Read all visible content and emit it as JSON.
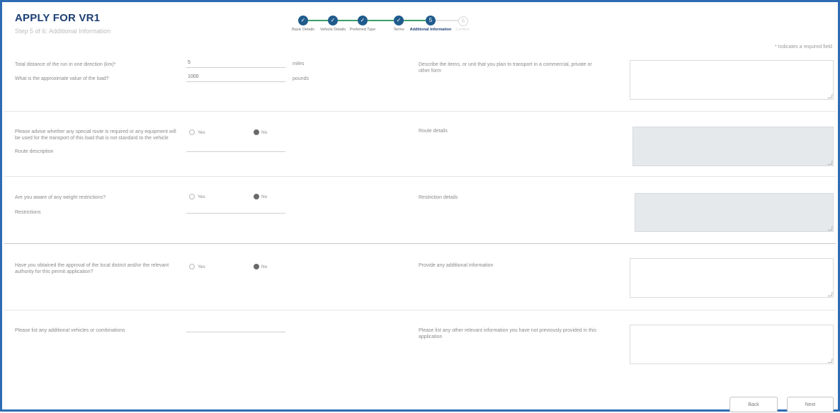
{
  "header": {
    "title": "APPLY FOR VR1",
    "subtitle": "Step 5 of 6: Additional Information"
  },
  "stepper": {
    "steps": [
      {
        "label": "Basic Details",
        "number": "✓"
      },
      {
        "label": "Vehicle Details",
        "number": "✓"
      },
      {
        "label": "Preferred Type",
        "number": "✓"
      },
      {
        "label": "Terms",
        "number": "✓"
      },
      {
        "label": "Additional Information",
        "number": "5"
      },
      {
        "label": "Confirm",
        "number": "6"
      }
    ]
  },
  "form": {
    "required_note": "* Indicates a required field",
    "section1": {
      "q1_label": "Total distance of the run in one direction (km)*",
      "q1_value": "5",
      "q1_unit": "miles",
      "q2_label": "What is the approximate value of the load?",
      "q2_value": "1000",
      "q2_unit": "pounds",
      "right_label": "Describe the items, or unit that you plan to transport in a commercial, private or other form"
    },
    "section2": {
      "question": "Please advise whether any special route is required or any equipment will be used for the transport of this load that is not standard to the vehicle",
      "opt_yes": "Yes",
      "opt_no": "No",
      "sub_label": "Route description",
      "right_label": "Route details"
    },
    "section3": {
      "question": "Are you aware of any weight restrictions?",
      "opt_yes": "Yes",
      "opt_no": "No",
      "sub_label": "Restrictions",
      "right_label": "Restriction details"
    },
    "section4": {
      "question": "Have you obtained the approval of the local district and/or the relevant authority for this permit application?",
      "opt_yes": "Yes",
      "opt_no": "No",
      "right_label": "Provide any additional information"
    },
    "section5": {
      "question": "Please list any additional vehicles or combinations",
      "right_label": "Please list any other relevant information you have not previously provided in this application"
    }
  },
  "actions": {
    "back_label": "Back",
    "next_label": "Next"
  }
}
